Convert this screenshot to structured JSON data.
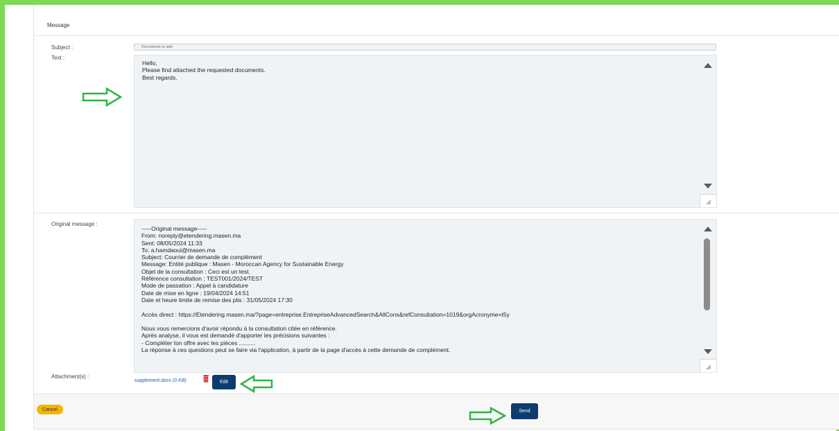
{
  "header": {
    "title": "Message"
  },
  "subject": {
    "label": "Subject :",
    "value": "Documents to add"
  },
  "text_field": {
    "label": "Text :",
    "value": "Hello,\nPlease find attached the requested documents.\nBest regards."
  },
  "original_message": {
    "label": "Original message :",
    "value": "-----Original message-----\nFrom: noreply@etendering.masen.ma\nSent: 08/05/2024 11:33\nTo: a.hamdaoui@masen.ma\nSubject: Courrier de demande de complément\nMessage: Entité publique : Masen - Moroccan Agency for Sustainable Energy\nObjet de la consultation : Ceci est un test.\nRéférence consultation : TEST001/2024/TEST\nMode de passation : Appel à candidature\nDate de mise en ligne : 19/04/2024 14:51\nDate et heure limite de remise des plis : 31/05/2024 17:30\n\nAccès direct : https://Etendering.masen.ma/?page=entreprise.EntrepriseAdvancedSearch&AllCons&refConsultation=1019&orgAcronyme=t5y\n\nNous vous remercions d'avoir répondu à la consultation citée en référence.\nAprès analyse, il vous est demandé d'apporter les précisions suivantes :\n- Compléter ton offre avec les pièces ..........\nLa réponse à ces questions peut se faire via l'application, à partir de la page d'accès à cette demande de complément."
  },
  "attachments": {
    "label": "Attachment(s) :",
    "file_name": "supplement.docx",
    "file_size": "(0 KB)",
    "edit_label": "Edit",
    "delete_icon": "trash-icon"
  },
  "footer": {
    "cancel_label": "Cancel",
    "send_label": "Send"
  },
  "colors": {
    "accent_green": "#7ed957",
    "primary_button": "#0d3c6e",
    "cancel_button": "#f5b400",
    "link": "#1a5fb4",
    "annotation_arrow": "#2fb344",
    "delete_icon": "#d62828"
  }
}
